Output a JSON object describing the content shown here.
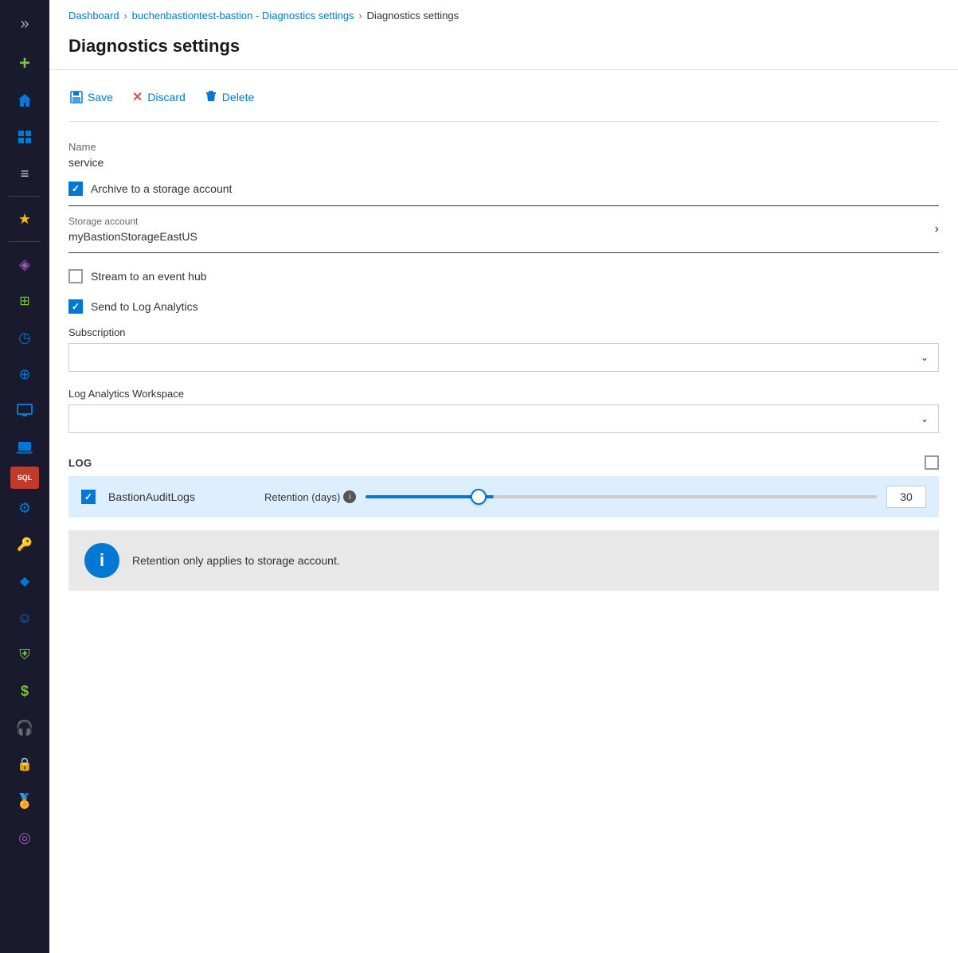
{
  "breadcrumb": {
    "items": [
      {
        "label": "Dashboard",
        "link": true
      },
      {
        "label": "buchenbastiontest-bastion - Diagnostics settings",
        "link": true
      },
      {
        "label": "Diagnostics settings",
        "link": false
      }
    ]
  },
  "page": {
    "title": "Diagnostics settings"
  },
  "toolbar": {
    "save_label": "Save",
    "discard_label": "Discard",
    "delete_label": "Delete"
  },
  "form": {
    "name_label": "Name",
    "name_value": "service",
    "archive_label": "Archive to a storage account",
    "archive_checked": true,
    "storage_account_label": "Storage account",
    "storage_account_value": "myBastionStorageEastUS",
    "event_hub_label": "Stream to an event hub",
    "event_hub_checked": false,
    "log_analytics_label": "Send to Log Analytics",
    "log_analytics_checked": true,
    "subscription_label": "Subscription",
    "subscription_placeholder": "",
    "log_analytics_workspace_label": "Log Analytics Workspace",
    "log_analytics_workspace_placeholder": ""
  },
  "log_section": {
    "title": "LOG",
    "rows": [
      {
        "name": "BastionAuditLogs",
        "checked": true,
        "retention_label": "Retention (days)",
        "retention_value": "30",
        "slider_percent": 22
      }
    ]
  },
  "info_banner": {
    "text": "Retention only applies to storage account."
  },
  "sidebar": {
    "icons": [
      {
        "name": "collapse-icon",
        "symbol": "»",
        "color": "#aaa"
      },
      {
        "name": "add-icon",
        "symbol": "+",
        "color": "#7dc142"
      },
      {
        "name": "home-icon",
        "symbol": "⌂",
        "color": "#0078d4"
      },
      {
        "name": "dashboard-icon",
        "symbol": "▦",
        "color": "#0078d4"
      },
      {
        "name": "list-icon",
        "symbol": "≡",
        "color": "#ccc"
      },
      {
        "name": "star-icon",
        "symbol": "★",
        "color": "#f0c000"
      },
      {
        "name": "cube-icon",
        "symbol": "◈",
        "color": "#9b59b6"
      },
      {
        "name": "grid-icon",
        "symbol": "⊞",
        "color": "#7dc142"
      },
      {
        "name": "clock-icon",
        "symbol": "◷",
        "color": "#0078d4"
      },
      {
        "name": "globe-icon",
        "symbol": "⊕",
        "color": "#0078d4"
      },
      {
        "name": "monitor-icon",
        "symbol": "▭",
        "color": "#0078d4"
      },
      {
        "name": "computer-icon",
        "symbol": "▤",
        "color": "#0078d4"
      },
      {
        "name": "sql-icon",
        "symbol": "SQL",
        "color": "#fff",
        "bg": "#e74c3c"
      },
      {
        "name": "settings-icon",
        "symbol": "⚙",
        "color": "#0078d4"
      },
      {
        "name": "key-icon",
        "symbol": "🔑",
        "color": "#f0c000"
      },
      {
        "name": "diamond-icon",
        "symbol": "◆",
        "color": "#0078d4"
      },
      {
        "name": "smiley-icon",
        "symbol": "☺",
        "color": "#0078d4"
      },
      {
        "name": "shield-icon",
        "symbol": "⛨",
        "color": "#7dc142"
      },
      {
        "name": "dollar-icon",
        "symbol": "$",
        "color": "#7dc142"
      },
      {
        "name": "headset-icon",
        "symbol": "⌀",
        "color": "#0078d4"
      },
      {
        "name": "lock-icon",
        "symbol": "🔒",
        "color": "#ccc"
      },
      {
        "name": "badge-icon",
        "symbol": "◉",
        "color": "#e74c3c"
      },
      {
        "name": "person-icon",
        "symbol": "◎",
        "color": "#9b59b6"
      }
    ]
  }
}
